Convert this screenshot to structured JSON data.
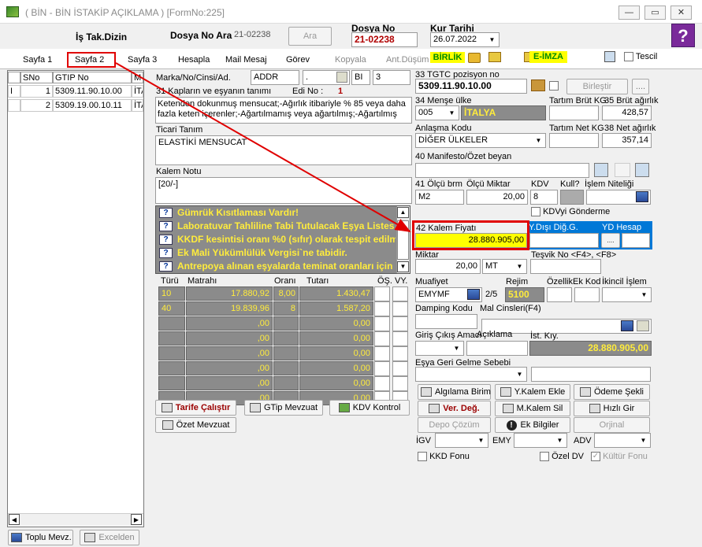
{
  "window": {
    "title": "( BİN - BİN İSTAKİP AÇIKLAMA ) [FormNo:225]",
    "minimize": "—",
    "maximize": "▭",
    "close": "✕"
  },
  "header": {
    "is_tak_dizin": "İş Tak.Dizin",
    "dosya_no_ara_label": "Dosya No Ara",
    "dosya_no_ara_value": "21-02238",
    "ara_button": "Ara",
    "dosya_no_label": "Dosya No",
    "dosya_no_value": "21-02238",
    "kur_tarihi_label": "Kur Tarihi",
    "kur_tarihi_value": "26.07.2022",
    "help": "?"
  },
  "tabs": [
    {
      "label": "Sayfa 1"
    },
    {
      "label": "Sayfa 2"
    },
    {
      "label": "Sayfa 3"
    },
    {
      "label": "Hesapla"
    },
    {
      "label": "Mail Mesaj"
    },
    {
      "label": "Görev"
    },
    {
      "label": "Kopyala"
    },
    {
      "label": "Ant.Düşüm"
    }
  ],
  "toolbar": {
    "birlik": "BİRLİK",
    "eimza": "E-İMZA",
    "tescil": "Tescil"
  },
  "left_grid": {
    "columns": [
      "SNo",
      "GTIP No",
      "M"
    ],
    "rows": [
      {
        "marker": "I",
        "sno": "1",
        "gtip": "5309.11.90.10.00",
        "m": "İTA"
      },
      {
        "marker": "",
        "sno": "2",
        "gtip": "5309.19.00.10.11",
        "m": "İTA"
      }
    ],
    "toplu_mevz": "Toplu Mevz.",
    "excelden": "Excelden"
  },
  "middle": {
    "marka_label": "Marka/No/Cinsi/Ad.",
    "marka_value": "ADDR",
    "marka_2": ".",
    "marka_3": "BI",
    "marka_4": "3",
    "kaplar_label": "31 Kapların ve eşyanın tanımı",
    "edi_label": "Edi No :",
    "edi_value": "1",
    "kaplar_text": "Ketenden dokunmuş mensucat;-Ağırlık itibariyle % 85 veya daha fazla keten içerenler;-Ağartılmamış veya ağartılmış;-Ağartılmış",
    "ticari_label": "Ticari Tanım",
    "ticari_value": "ELASTİKİ MENSUCAT",
    "kalem_notu_label": "Kalem Notu",
    "kalem_notu_value": "[20/-]",
    "messages": [
      "Gümrük Kısıtlaması Vardır!",
      "Laboratuvar Tahliline Tabi Tutulacak Eşya Listes",
      "KKDF kesintisi oranı %0 (sıfır) olarak tespit edilmi",
      "Ek Mali Yükümlülük Vergisi`ne tabidir.",
      "Antrepoya alınan eşyalarda teminat oranları için ["
    ],
    "tax_columns": [
      "Türü",
      "Matrahı",
      "Oranı",
      "Tutarı",
      "ÖŞ.",
      "VY."
    ],
    "tax_rows": [
      {
        "tur": "10",
        "matrah": "17.880,92",
        "oran": "8,00",
        "tutar": "1.430,47"
      },
      {
        "tur": "40",
        "matrah": "19.839,96",
        "oran": "8",
        "tutar": "1.587,20"
      },
      {
        "tur": "",
        "matrah": ",00",
        "oran": "",
        "tutar": "0,00"
      },
      {
        "tur": "",
        "matrah": ",00",
        "oran": "",
        "tutar": "0,00"
      },
      {
        "tur": "",
        "matrah": ",00",
        "oran": "",
        "tutar": "0,00"
      },
      {
        "tur": "",
        "matrah": ",00",
        "oran": "",
        "tutar": "0,00"
      },
      {
        "tur": "",
        "matrah": ",00",
        "oran": "",
        "tutar": "0,00"
      },
      {
        "tur": "",
        "matrah": ",00",
        "oran": "",
        "tutar": "0,00"
      }
    ],
    "tarife_button": "Tarife Çalıştır",
    "gtip_mevzuat_button": "GTip Mevzuat",
    "kdv_kontrol_button": "KDV Kontrol",
    "ozet_mevzuat_button": "Özet Mevzuat"
  },
  "right": {
    "tgtc_label": "33 TGTC pozisyon no",
    "tgtc_value": "5309.11.90.10.00",
    "birlestir": "Birleştir",
    "dots": "....",
    "mense_label": "34 Menşe ülke",
    "mense_code": "005",
    "mense_name": "İTALYA",
    "tartim_brut_label": "Tartım Brüt KG",
    "brut_label": "35 Brüt ağırlık",
    "brut_value": "428,57",
    "anlasma_label": "Anlaşma Kodu",
    "anlasma_value": "DİĞER ÜLKELER",
    "tartim_net_label": "Tartım Net KG",
    "net_label": "38 Net ağırlık",
    "net_value": "357,14",
    "manifesto_label": "40 Manifesto/Özet beyan",
    "olcu_brm_label": "41 Ölçü brm",
    "olcu_brm_value": "M2",
    "olcu_miktar_label": "Ölçü Miktar",
    "olcu_miktar_value": "20,00",
    "kdv_label": "KDV",
    "kdv_value": "8",
    "kull_label": "Kull?",
    "islem_niteligi_label": "İşlem Niteliği",
    "kdvyi_gonderme": "KDVyi Gönderme",
    "kalem_fiyati_label": "42 Kalem Fiyatı",
    "kalem_fiyati_value": "28.880.905,00",
    "ydisi_label": "Y.Dışı Diğ.G.",
    "yd_hesap_label": "YD Hesap",
    "miktar_label": "Miktar",
    "miktar_value": "20,00",
    "miktar_unit": "MT",
    "tesvik_label": "Teşvik No <F4>, <F8>",
    "muafiyet_label": "Muafiyet",
    "muafiyet_value": "EMYMF",
    "muafiyet_count": "2/5",
    "rejim_label": "Rejim",
    "rejim_value": "5100",
    "ozellik_label": "Özellik",
    "ek_kod_label": "Ek Kod",
    "ikincil_islem_label": "İkincil İşlem",
    "damping_label": "Damping Kodu",
    "mal_cinsleri_label": "Mal Cinsleri(F4)",
    "giris_cikis_label": "Giriş Çıkış Amacı",
    "aciklama_label": "Açıklama",
    "ist_kiy_label": "İst. Kıy.",
    "ist_kiy_value": "28.880.905,00",
    "esya_geri_label": "Eşya Geri Gelme Sebebi",
    "buttons": {
      "algilama": "Algılama Birim",
      "y_kalem_ekle": "Y.Kalem Ekle",
      "odeme_sekli": "Ödeme Şekli",
      "ver_deg": "Ver. Değ.",
      "m_kalem_sil": "M.Kalem Sil",
      "hizli_gir": "Hızlı Gir",
      "depo_cozum": "Depo Çözüm",
      "ek_bilgiler": "Ek Bilgiler",
      "orjinal": "Orjinal"
    },
    "igv_label": "İGV",
    "emy_label": "EMY",
    "adv_label": "ADV",
    "kkd_fonu": "KKD Fonu",
    "ozel_dv": "Özel DV",
    "kultur_fonu": "Kültür Fonu"
  }
}
